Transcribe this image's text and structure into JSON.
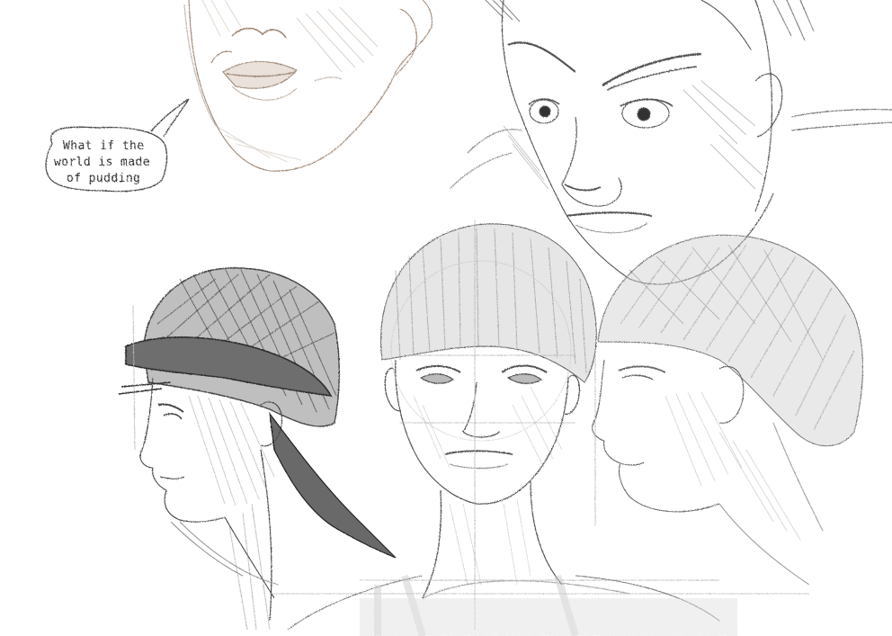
{
  "artwork": {
    "speech_bubble": {
      "lines": [
        "What if the",
        "world is made",
        "of pudding"
      ]
    },
    "colors": {
      "paper": "#ffffff",
      "pencil_gray": "#6b6b6b",
      "pencil_light": "#b8b8b8",
      "sepia": "#a08a78",
      "dark_tone": "#5a5a5a",
      "mid_tone": "#9c9c9c"
    }
  }
}
